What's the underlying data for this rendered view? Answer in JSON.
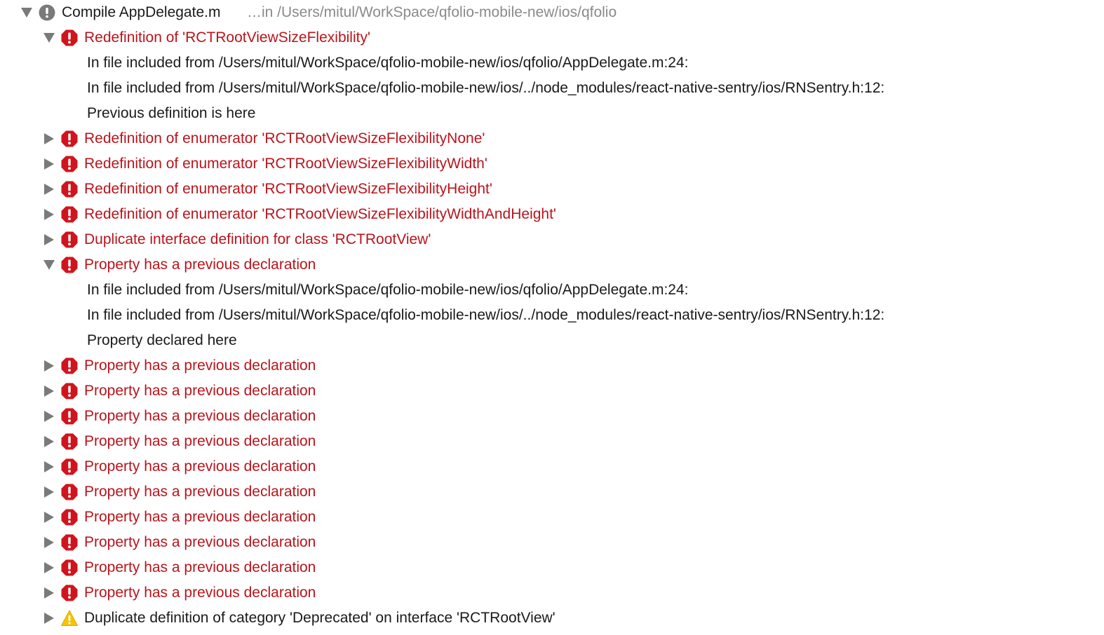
{
  "group": {
    "title": "Compile AppDelegate.m",
    "location": "…in /Users/mitul/WorkSpace/qfolio-mobile-new/ios/qfolio",
    "icon": "info-circle-icon"
  },
  "colors": {
    "error": "#b9141c",
    "warning": "#f5c400",
    "group_icon": "#7a7a7a",
    "text": "#1a1a1a",
    "muted": "#8a8a8a"
  },
  "issues": [
    {
      "type": "error",
      "expanded": true,
      "title": "Redefinition of 'RCTRootViewSizeFlexibility'",
      "notes": [
        "In file included from /Users/mitul/WorkSpace/qfolio-mobile-new/ios/qfolio/AppDelegate.m:24:",
        "In file included from /Users/mitul/WorkSpace/qfolio-mobile-new/ios/../node_modules/react-native-sentry/ios/RNSentry.h:12:",
        "Previous definition is here"
      ]
    },
    {
      "type": "error",
      "expanded": false,
      "title": "Redefinition of enumerator 'RCTRootViewSizeFlexibilityNone'"
    },
    {
      "type": "error",
      "expanded": false,
      "title": "Redefinition of enumerator 'RCTRootViewSizeFlexibilityWidth'"
    },
    {
      "type": "error",
      "expanded": false,
      "title": "Redefinition of enumerator 'RCTRootViewSizeFlexibilityHeight'"
    },
    {
      "type": "error",
      "expanded": false,
      "title": "Redefinition of enumerator 'RCTRootViewSizeFlexibilityWidthAndHeight'"
    },
    {
      "type": "error",
      "expanded": false,
      "title": "Duplicate interface definition for class 'RCTRootView'"
    },
    {
      "type": "error",
      "expanded": true,
      "title": "Property has a previous declaration",
      "notes": [
        "In file included from /Users/mitul/WorkSpace/qfolio-mobile-new/ios/qfolio/AppDelegate.m:24:",
        "In file included from /Users/mitul/WorkSpace/qfolio-mobile-new/ios/../node_modules/react-native-sentry/ios/RNSentry.h:12:",
        "Property declared here"
      ]
    },
    {
      "type": "error",
      "expanded": false,
      "title": "Property has a previous declaration"
    },
    {
      "type": "error",
      "expanded": false,
      "title": "Property has a previous declaration"
    },
    {
      "type": "error",
      "expanded": false,
      "title": "Property has a previous declaration"
    },
    {
      "type": "error",
      "expanded": false,
      "title": "Property has a previous declaration"
    },
    {
      "type": "error",
      "expanded": false,
      "title": "Property has a previous declaration"
    },
    {
      "type": "error",
      "expanded": false,
      "title": "Property has a previous declaration"
    },
    {
      "type": "error",
      "expanded": false,
      "title": "Property has a previous declaration"
    },
    {
      "type": "error",
      "expanded": false,
      "title": "Property has a previous declaration"
    },
    {
      "type": "error",
      "expanded": false,
      "title": "Property has a previous declaration"
    },
    {
      "type": "error",
      "expanded": false,
      "title": "Property has a previous declaration"
    },
    {
      "type": "warning",
      "expanded": false,
      "title": "Duplicate definition of category 'Deprecated' on interface 'RCTRootView'"
    }
  ]
}
